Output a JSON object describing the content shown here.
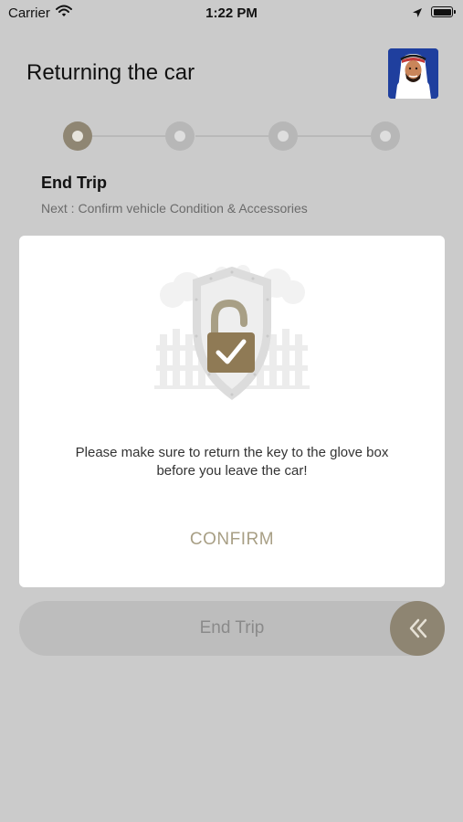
{
  "status_bar": {
    "carrier": "Carrier",
    "time": "1:22 PM"
  },
  "header": {
    "title": "Returning the car"
  },
  "stepper": {
    "steps": [
      {
        "state": "done"
      },
      {
        "state": "todo"
      },
      {
        "state": "todo"
      },
      {
        "state": "todo"
      }
    ],
    "current_step_title": "End Trip",
    "next_step_text": "Next : Confirm vehicle Condition & Accessories"
  },
  "modal": {
    "illustration_icon": "shield-unlocked-padlock-check-icon",
    "message_line1": "Please make sure to return the key to the glove box",
    "message_line2": "before you leave the car!",
    "confirm_label": "CONFIRM"
  },
  "slider": {
    "label": "End Trip",
    "handle_icon": "double-chevron-left-icon"
  },
  "colors": {
    "accent": "#8f8673",
    "accent_text": "#a89f85",
    "overlay_background": "#cbcbcb",
    "avatar_background": "#1f3f9e"
  }
}
